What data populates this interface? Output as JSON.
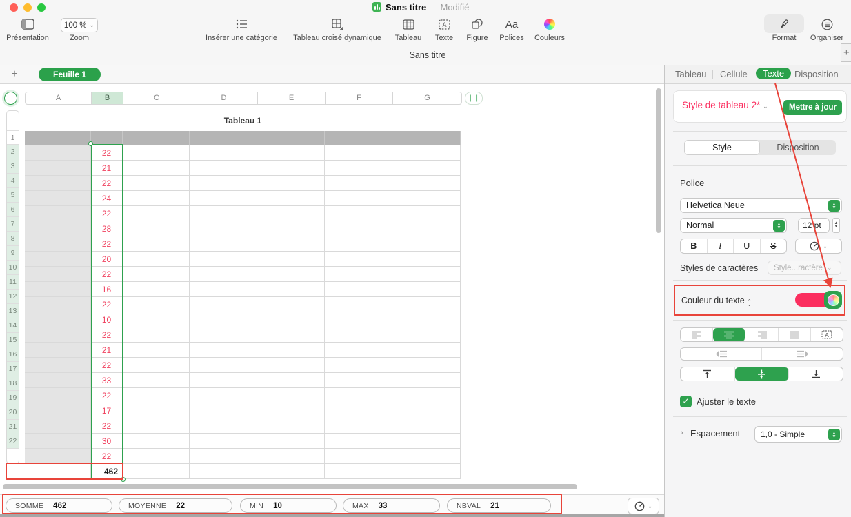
{
  "window": {
    "title": "Sans titre",
    "modified_text": "—  Modifié",
    "subtitle": "Sans titre"
  },
  "toolbar": {
    "view_label": "Présentation",
    "zoom_label": "Zoom",
    "zoom_value": "100 %",
    "insert_category_label": "Insérer une catégorie",
    "pivot_label": "Tableau croisé dynamique",
    "table_label": "Tableau",
    "text_label": "Texte",
    "shape_label": "Figure",
    "fonts_label": "Polices",
    "fonts_glyph": "Aa",
    "colors_label": "Couleurs",
    "format_label": "Format",
    "organize_label": "Organiser"
  },
  "sheetbar": {
    "add_sheet": "+",
    "tab_label": "Feuille 1"
  },
  "grid": {
    "table_title": "Tableau 1",
    "columns": [
      "A",
      "B",
      "C",
      "D",
      "E",
      "F",
      "G"
    ],
    "selected_column": "B",
    "add_column_glyph": "❙❙",
    "first_data_row": 2,
    "values_column_b": [
      22,
      21,
      22,
      24,
      22,
      28,
      22,
      20,
      22,
      16,
      22,
      10,
      22,
      21,
      22,
      33,
      22,
      17,
      22,
      30,
      22
    ],
    "footer_total": "462"
  },
  "statusbar": {
    "stats": [
      {
        "label": "SOMME",
        "value": "462"
      },
      {
        "label": "MOYENNE",
        "value": "22"
      },
      {
        "label": "MIN",
        "value": "10"
      },
      {
        "label": "MAX",
        "value": "33"
      },
      {
        "label": "NBVAL",
        "value": "21"
      }
    ]
  },
  "sidebar": {
    "tabs": [
      "Tableau",
      "Cellule",
      "Texte",
      "Disposition"
    ],
    "active_tab": "Texte",
    "table_style_name": "Style de tableau 2*",
    "update_button": "Mettre à jour",
    "style_tab": "Style",
    "layout_tab": "Disposition",
    "font_section_label": "Police",
    "font_family": "Helvetica Neue",
    "font_weight": "Normal",
    "font_size": "12 pt",
    "bold_glyph": "B",
    "italic_glyph": "I",
    "underline_glyph": "U",
    "strikethrough_glyph": "S",
    "char_styles_label": "Styles de caractères",
    "char_styles_value": "Style...ractère",
    "text_color_label": "Couleur du texte",
    "fit_text_label": "Ajuster le texte",
    "spacing_label": "Espacement",
    "spacing_value": "1,0 - Simple"
  },
  "colors": {
    "accent_green": "#2ea14e",
    "sheet_tab_green": "#2ba14b",
    "cell_value_red": "#f0405e",
    "style_name_pink": "#fb2e5f",
    "text_color_swatch": "#fb2e5f",
    "annotation_red": "#e8443a",
    "header_row_gray": "#b5b5b5",
    "header_col_gray": "#e4e4e4"
  }
}
